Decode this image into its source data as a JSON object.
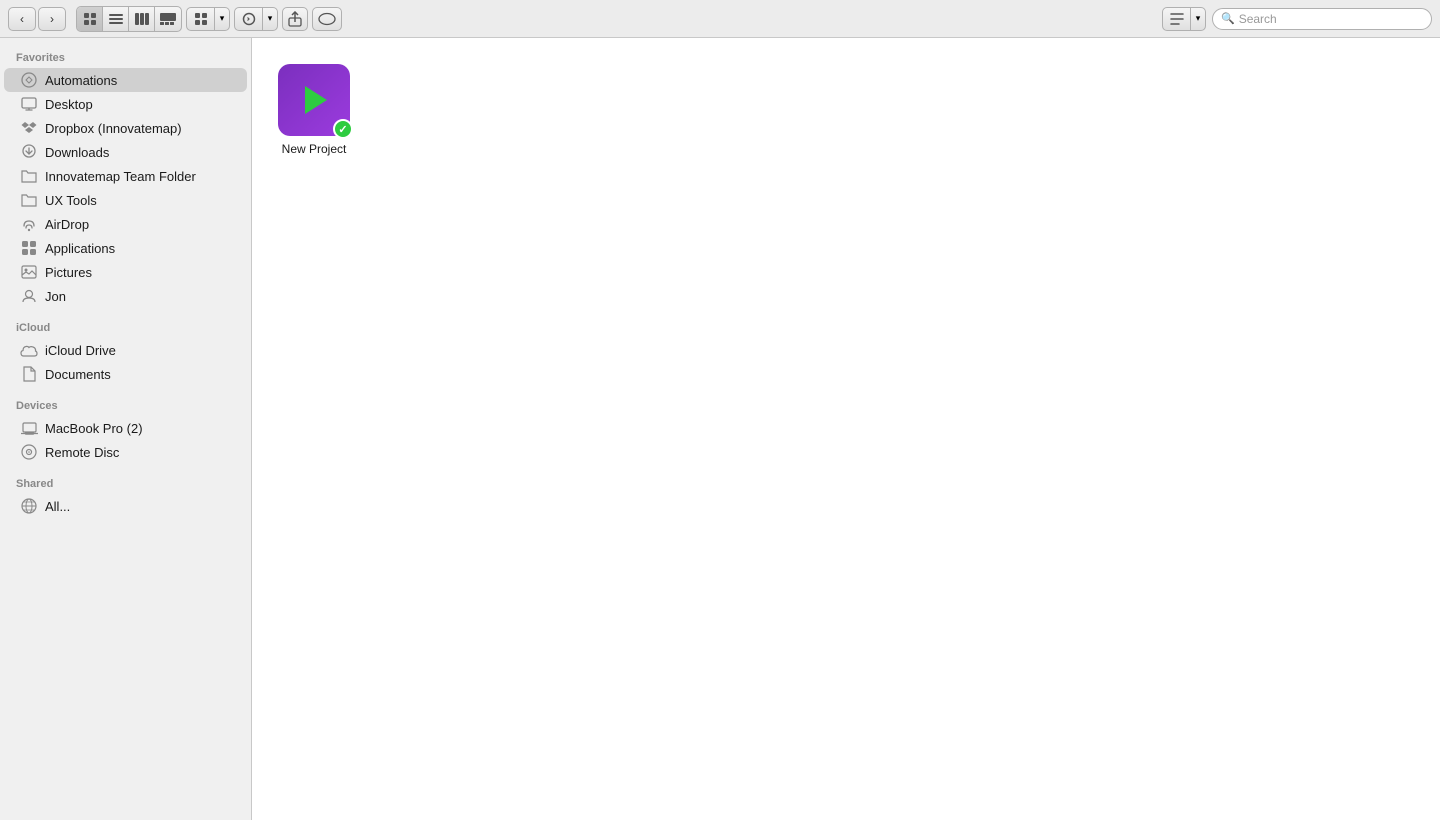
{
  "toolbar": {
    "back_label": "‹",
    "forward_label": "›",
    "view_icon_label": "⊞",
    "view_list_label": "≡",
    "view_column_label": "▦",
    "view_cover_label": "▣",
    "arrange_label": "⊞",
    "arrange_arrow": "▾",
    "action_label": "⚙",
    "action_arrow": "▾",
    "share_label": "⬆",
    "tag_label": "○",
    "search_placeholder": "Search",
    "action_icon": "⚙"
  },
  "sidebar": {
    "favorites_header": "Favorites",
    "icloud_header": "iCloud",
    "devices_header": "Devices",
    "shared_header": "Shared",
    "favorites": [
      {
        "id": "automations",
        "label": "Automations",
        "icon": "🔁",
        "active": true
      },
      {
        "id": "desktop",
        "label": "Desktop",
        "icon": "🖥"
      },
      {
        "id": "dropbox",
        "label": "Dropbox (Innovatemap)",
        "icon": "📦"
      },
      {
        "id": "downloads",
        "label": "Downloads",
        "icon": "⬇"
      },
      {
        "id": "innovatemap-team",
        "label": "Innovatemap Team Folder",
        "icon": "📁"
      },
      {
        "id": "ux-tools",
        "label": "UX Tools",
        "icon": "📁"
      },
      {
        "id": "airdrop",
        "label": "AirDrop",
        "icon": "📡"
      },
      {
        "id": "applications",
        "label": "Applications",
        "icon": "🔲"
      },
      {
        "id": "pictures",
        "label": "Pictures",
        "icon": "🖼"
      },
      {
        "id": "jon",
        "label": "Jon",
        "icon": "🏠"
      }
    ],
    "icloud": [
      {
        "id": "icloud-drive",
        "label": "iCloud Drive",
        "icon": "☁"
      },
      {
        "id": "documents",
        "label": "Documents",
        "icon": "📄"
      }
    ],
    "devices": [
      {
        "id": "macbook-pro",
        "label": "MacBook Pro (2)",
        "icon": "💻"
      },
      {
        "id": "remote-disc",
        "label": "Remote Disc",
        "icon": "💿"
      }
    ],
    "shared": [
      {
        "id": "all",
        "label": "All...",
        "icon": "🌐"
      }
    ]
  },
  "content": {
    "file": {
      "name": "New Project",
      "icon_color_top": "#7B2FBE",
      "icon_color_bottom": "#9B3BDE"
    }
  }
}
